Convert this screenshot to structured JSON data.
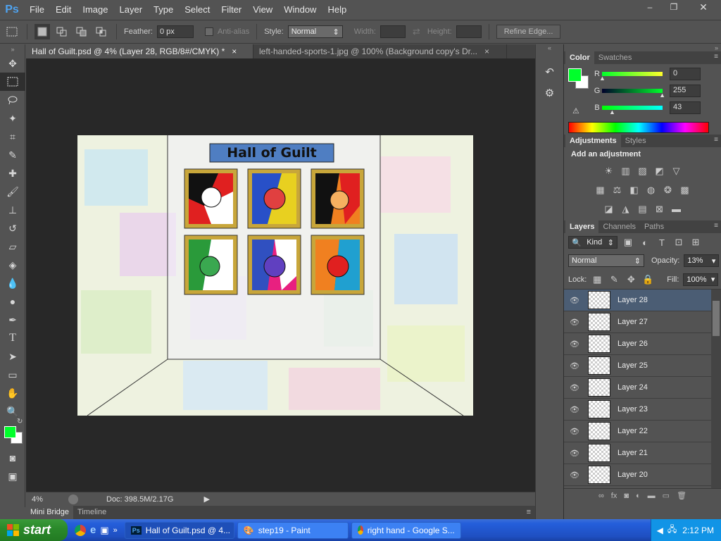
{
  "app": {
    "logo": "Ps"
  },
  "menu": [
    "File",
    "Edit",
    "Image",
    "Layer",
    "Type",
    "Select",
    "Filter",
    "View",
    "Window",
    "Help"
  ],
  "window_controls": {
    "minimize": "–",
    "maximize": "❐",
    "close": "✕"
  },
  "options": {
    "feather_label": "Feather:",
    "feather_value": "0 px",
    "antialias_label": "Anti-alias",
    "style_label": "Style:",
    "style_value": "Normal",
    "width_label": "Width:",
    "height_label": "Height:",
    "refine_edge": "Refine Edge..."
  },
  "tabs": [
    {
      "label": "Hall of Guilt.psd @ 4% (Layer 28, RGB/8#/CMYK) *",
      "close": "×"
    },
    {
      "label": "left-handed-sports-1.jpg @ 100% (Background copy's Dr...",
      "close": "×"
    }
  ],
  "artwork": {
    "title": "Hall of Guilt"
  },
  "status": {
    "zoom": "4%",
    "doc": "Doc: 398.5M/2.17G"
  },
  "bottom_tabs": [
    "Mini Bridge",
    "Timeline"
  ],
  "color_panel": {
    "tabs": [
      "Color",
      "Swatches"
    ],
    "r_label": "R",
    "r_value": "0",
    "g_label": "G",
    "g_value": "255",
    "b_label": "B",
    "b_value": "43",
    "foreground": "#00ff2b"
  },
  "adjustments": {
    "tabs": [
      "Adjustments",
      "Styles"
    ],
    "heading": "Add an adjustment"
  },
  "layers_panel": {
    "tabs": [
      "Layers",
      "Channels",
      "Paths"
    ],
    "filter_kind": "Kind",
    "blend_mode": "Normal",
    "opacity_label": "Opacity:",
    "opacity_value": "13%",
    "lock_label": "Lock:",
    "fill_label": "Fill:",
    "fill_value": "100%",
    "layers": [
      "Layer 28",
      "Layer 27",
      "Layer 26",
      "Layer 25",
      "Layer 24",
      "Layer 23",
      "Layer 22",
      "Layer 21",
      "Layer 20"
    ]
  },
  "taskbar": {
    "start": "start",
    "items": [
      "Hall of Guilt.psd @ 4...",
      "step19 - Paint",
      "right hand - Google S..."
    ],
    "time": "2:12 PM"
  }
}
